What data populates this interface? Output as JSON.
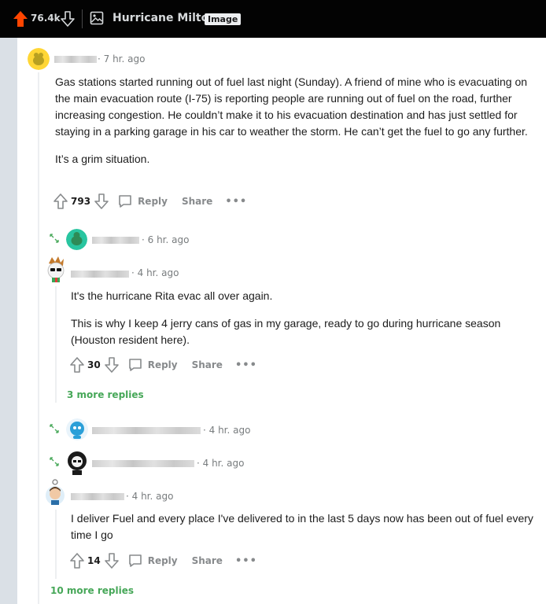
{
  "topbar": {
    "score": "76.4k",
    "title": "Hurricane Milton",
    "flair": "Image"
  },
  "comments": [
    {
      "time": "· 7 hr. ago",
      "paragraphs": [
        "Gas stations started running out of fuel last night (Sunday). A friend of mine who is evacuating on the main evacuation route (I-75) is reporting people are running out of fuel on the road, further increasing congestion. He couldn’t make it to his evacuation destination and has just settled for staying in a parking garage in his car to weather the storm. He can’t get the fuel to go any further.",
        "It’s a grim situation."
      ],
      "score": "793",
      "reply": "Reply",
      "share": "Share"
    },
    {
      "time": "· 6 hr. ago"
    },
    {
      "time": "· 4 hr. ago",
      "paragraphs": [
        "It's the hurricane Rita evac all over again.",
        "This is why I keep 4 jerry cans of gas in my garage, ready to go during hurricane season (Houston resident here)."
      ],
      "score": "30",
      "reply": "Reply",
      "share": "Share",
      "more_replies": "3 more replies"
    },
    {
      "time": "· 4 hr. ago"
    },
    {
      "time": "· 4 hr. ago"
    },
    {
      "time": "· 4 hr. ago",
      "paragraphs": [
        "I deliver Fuel and every place I've delivered to in the last 5 days now has been out of fuel every time I go"
      ],
      "score": "14",
      "reply": "Reply",
      "share": "Share"
    }
  ],
  "more_replies_bottom": "10 more replies",
  "colors": {
    "upvote_orange": "#ff4500",
    "more_replies_green": "#46a758",
    "topbar_bg": "#030303"
  }
}
